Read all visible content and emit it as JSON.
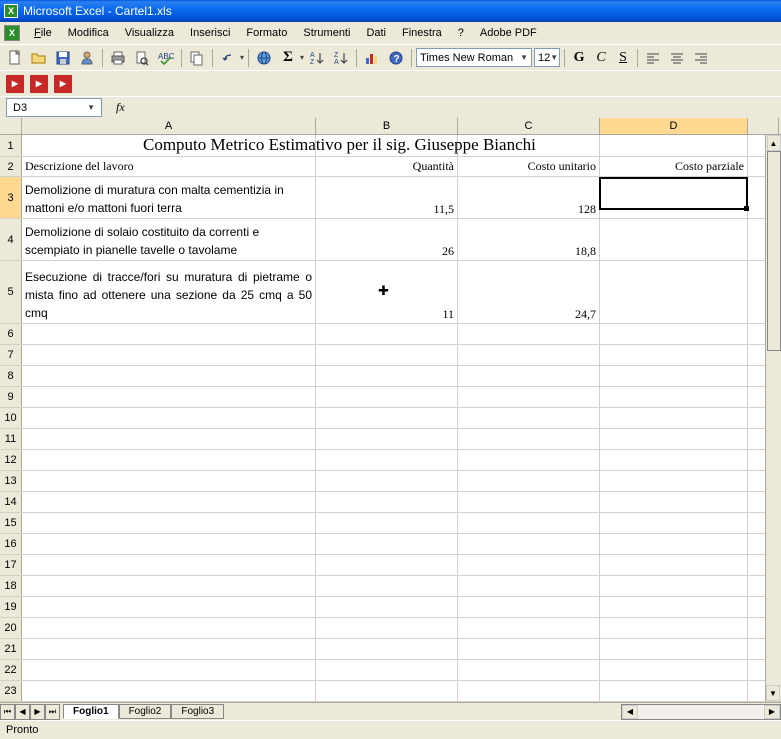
{
  "app": {
    "title": "Microsoft Excel - Cartel1.xls"
  },
  "menu": {
    "file": "File",
    "modifica": "Modifica",
    "visualizza": "Visualizza",
    "inserisci": "Inserisci",
    "formato": "Formato",
    "strumenti": "Strumenti",
    "dati": "Dati",
    "finestra": "Finestra",
    "help": "?",
    "adobe": "Adobe PDF"
  },
  "toolbar": {
    "font_name": "Times New Roman",
    "font_size": "12",
    "bold": "G",
    "italic": "C",
    "underline": "S"
  },
  "namebox": {
    "ref": "D3",
    "fx": "fx"
  },
  "columns": {
    "A": "A",
    "B": "B",
    "C": "C",
    "D": "D",
    "E": ""
  },
  "rows": [
    "1",
    "2",
    "3",
    "4",
    "5",
    "6",
    "7",
    "8",
    "9",
    "10",
    "11",
    "12",
    "13",
    "14",
    "15",
    "16",
    "17",
    "18",
    "19",
    "20",
    "21",
    "22",
    "23"
  ],
  "cells": {
    "title": "Computo Metrico Estimativo per il sig. Giuseppe Bianchi",
    "h_desc": "Descrizione del lavoro",
    "h_qty": "Quantità",
    "h_unit": "Costo unitario",
    "h_part": "Costo parziale",
    "r3_desc": "Demolizione di muratura con malta cementizia in mattoni e/o mattoni fuori terra",
    "r3_qty": "11,5",
    "r3_unit": "128",
    "r4_desc": "Demolizione di solaio costituito da correnti e scempiato in pianelle tavelle o tavolame",
    "r4_qty": "26",
    "r4_unit": "18,8",
    "r5_desc": "Esecuzione di tracce/fori su muratura di pietrame o mista fino ad ottenere una sezione da 25 cmq a 50 cmq",
    "r5_qty": "11",
    "r5_unit": "24,7"
  },
  "tabs": {
    "active": "Foglio1",
    "t2": "Foglio2",
    "t3": "Foglio3"
  },
  "status": {
    "ready": "Pronto"
  }
}
